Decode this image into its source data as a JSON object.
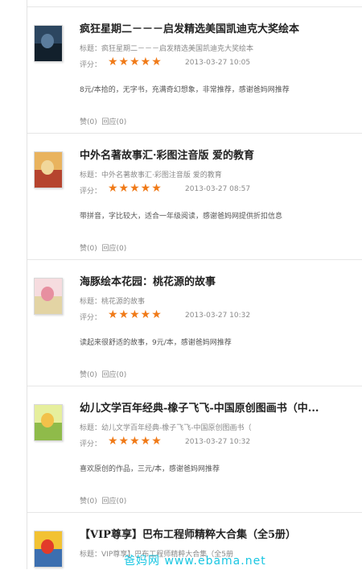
{
  "labels": {
    "title_prefix": "标题：",
    "rating_prefix": "评分："
  },
  "stars": "★★★★★",
  "reviews": [
    {
      "title": "疯狂星期二－－－启发精选美国凯迪克大奖绘本",
      "subtitle": "疯狂星期二－－－启发精选美国凯迪克大奖绘本",
      "date": "2013-03-27 10:05",
      "comment": "8元/本拾的，无字书，充满奇幻想象，非常推荐，感谢爸妈网推荐",
      "like": "赞(0)",
      "reply": "回应(0)"
    },
    {
      "title": "中外名著故事汇·彩图注音版 爱的教育",
      "subtitle": "中外名著故事汇·彩图注音版 爱的教育",
      "date": "2013-03-27 08:57",
      "comment": "带拼音，字比较大，适合一年级阅读，感谢爸妈网提供折扣信息",
      "like": "赞(0)",
      "reply": "回应(0)"
    },
    {
      "title": "海豚绘本花园：桃花源的故事",
      "subtitle": "桃花源的故事",
      "date": "2013-03-27 10:32",
      "comment": "读起来很舒适的故事，9元/本，感谢爸妈网推荐",
      "like": "赞(0)",
      "reply": "回应(0)"
    },
    {
      "title": "幼儿文学百年经典-橡子飞飞-中国原创图画书（中...",
      "subtitle": "幼儿文学百年经典-橡子飞飞-中国原创图画书（",
      "date": "2013-03-27 10:32",
      "comment": "喜欢原创的作品，三元/本，感谢爸妈网推荐",
      "like": "赞(0)",
      "reply": "回应(0)"
    },
    {
      "title": "【VIP尊享】巴布工程师精粹大合集（全5册）",
      "subtitle": "VIP尊享】巴布工程师精粹大合集（全5册",
      "date": "",
      "comment": "",
      "like": "",
      "reply": ""
    }
  ],
  "watermark": "爸妈网 www.ebama.net"
}
